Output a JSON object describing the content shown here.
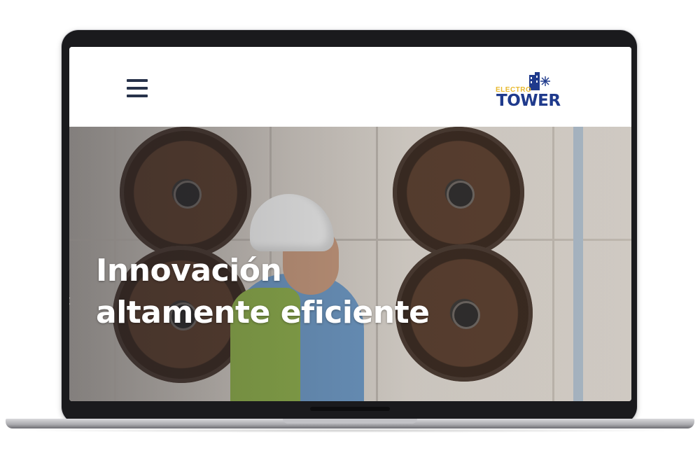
{
  "header": {
    "menu_icon": "hamburger-menu-icon",
    "logo": {
      "top_text": "ELECTRO",
      "bottom_text": "TOWER",
      "colors": {
        "top": "#e8b92e",
        "bottom": "#1f3a8c"
      }
    }
  },
  "hero": {
    "title_line_1": "Innovación",
    "title_line_2": "altamente eficiente",
    "prev_arrow": "‹"
  },
  "colors": {
    "menu_icon": "#27324a",
    "hero_text": "#ffffff"
  }
}
